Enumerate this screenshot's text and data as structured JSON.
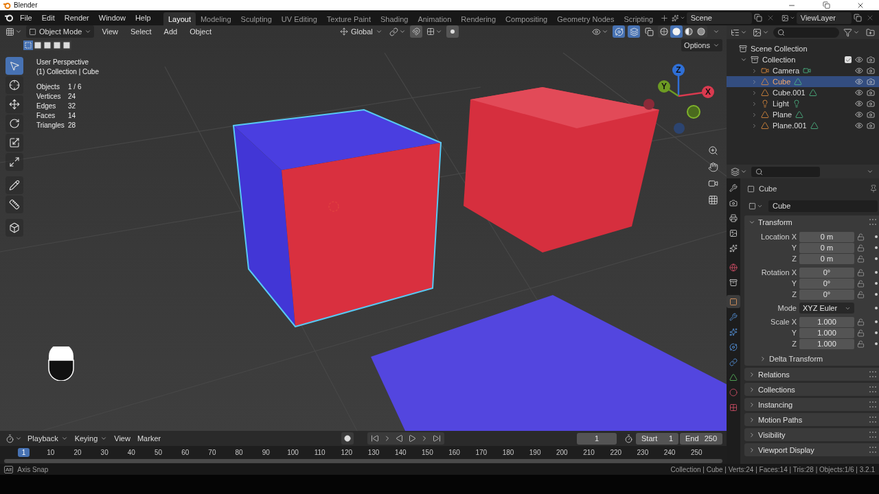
{
  "window": {
    "title": "Blender"
  },
  "menu": [
    "File",
    "Edit",
    "Render",
    "Window",
    "Help"
  ],
  "workspaces": [
    {
      "label": "Layout",
      "selected": true
    },
    {
      "label": "Modeling",
      "selected": false
    },
    {
      "label": "Sculpting",
      "selected": false
    },
    {
      "label": "UV Editing",
      "selected": false
    },
    {
      "label": "Texture Paint",
      "selected": false
    },
    {
      "label": "Shading",
      "selected": false
    },
    {
      "label": "Animation",
      "selected": false
    },
    {
      "label": "Rendering",
      "selected": false
    },
    {
      "label": "Compositing",
      "selected": false
    },
    {
      "label": "Geometry Nodes",
      "selected": false
    },
    {
      "label": "Scripting",
      "selected": false
    }
  ],
  "scene": {
    "value": "Scene"
  },
  "view_layer": {
    "value": "ViewLayer"
  },
  "viewport": {
    "mode": "Object Mode",
    "menus": [
      "View",
      "Select",
      "Add",
      "Object"
    ],
    "orientation": "Global",
    "options": "Options",
    "toggles": [
      {
        "kind": "gizmo",
        "on": true
      },
      {
        "kind": "overlay",
        "on": true
      },
      {
        "kind": "xray",
        "on": false
      }
    ],
    "shading": [
      {
        "kind": "wireframe",
        "selected": false
      },
      {
        "kind": "solid",
        "selected": true
      },
      {
        "kind": "material",
        "selected": false
      },
      {
        "kind": "rendered",
        "selected": false
      }
    ],
    "select_modes": [
      {
        "selected": true
      },
      {
        "selected": false
      },
      {
        "selected": false
      },
      {
        "selected": false
      },
      {
        "selected": false
      }
    ],
    "tools": [
      {
        "kind": "select",
        "selected": true
      },
      {
        "kind": "cursor",
        "selected": false
      },
      {
        "kind": "move",
        "selected": false
      },
      {
        "kind": "rotate",
        "selected": false
      },
      {
        "kind": "scale",
        "selected": false
      },
      {
        "kind": "transform",
        "selected": false
      },
      {
        "kind": "annotate",
        "selected": false
      },
      {
        "kind": "measure",
        "selected": false
      },
      {
        "kind": "add",
        "selected": false
      }
    ],
    "perspective": "User Perspective",
    "context": "(1) Collection | Cube",
    "stats": [
      {
        "label": "Objects",
        "value": "1 / 6"
      },
      {
        "label": "Vertices",
        "value": "24"
      },
      {
        "label": "Edges",
        "value": "32"
      },
      {
        "label": "Faces",
        "value": "14"
      },
      {
        "label": "Triangles",
        "value": "28"
      }
    ],
    "gizmo": [
      "Z",
      "Y",
      "X"
    ]
  },
  "outliner": {
    "root": "Scene Collection",
    "collection": {
      "label": "Collection",
      "expanded": true,
      "checked": true,
      "children": [
        {
          "label": "Camera",
          "kind": "camera",
          "selected": false
        },
        {
          "label": "Cube",
          "kind": "mesh",
          "selected": true
        },
        {
          "label": "Cube.001",
          "kind": "mesh",
          "selected": false
        },
        {
          "label": "Light",
          "kind": "light",
          "selected": false
        },
        {
          "label": "Plane",
          "kind": "mesh",
          "selected": false
        },
        {
          "label": "Plane.001",
          "kind": "mesh",
          "selected": false
        }
      ]
    }
  },
  "properties": {
    "object": "Cube",
    "name_field": "Cube",
    "tabs": [
      {
        "kind": "tool",
        "selected": false
      },
      {
        "kind": "render",
        "selected": false
      },
      {
        "kind": "output",
        "selected": false
      },
      {
        "kind": "view-layer",
        "selected": false
      },
      {
        "kind": "scene",
        "selected": false
      },
      {
        "kind": "world",
        "selected": false
      },
      {
        "kind": "collection",
        "selected": false
      },
      {
        "kind": "object",
        "selected": true
      },
      {
        "kind": "modifier",
        "selected": false
      },
      {
        "kind": "particles",
        "selected": false
      },
      {
        "kind": "physics",
        "selected": false
      },
      {
        "kind": "constraints",
        "selected": false
      },
      {
        "kind": "data",
        "selected": false
      },
      {
        "kind": "material",
        "selected": false
      },
      {
        "kind": "texture",
        "selected": false
      }
    ],
    "transform": {
      "title": "Transform",
      "expanded": true,
      "groups": [
        [
          {
            "label": "Location X",
            "value": "0 m",
            "kind": "number",
            "locked": false
          },
          {
            "label": "Y",
            "value": "0 m",
            "kind": "number",
            "locked": false
          },
          {
            "label": "Z",
            "value": "0 m",
            "kind": "number",
            "locked": false
          }
        ],
        [
          {
            "label": "Rotation X",
            "value": "0°",
            "kind": "number",
            "locked": false
          },
          {
            "label": "Y",
            "value": "0°",
            "kind": "number",
            "locked": false
          },
          {
            "label": "Z",
            "value": "0°",
            "kind": "number",
            "locked": false
          }
        ],
        [
          {
            "label": "Mode",
            "value": "XYZ Euler",
            "kind": "dropdown"
          }
        ],
        [
          {
            "label": "Scale X",
            "value": "1.000",
            "kind": "number",
            "locked": false
          },
          {
            "label": "Y",
            "value": "1.000",
            "kind": "number",
            "locked": false
          },
          {
            "label": "Z",
            "value": "1.000",
            "kind": "number",
            "locked": false
          }
        ]
      ],
      "subpanel": {
        "title": "Delta Transform",
        "expanded": false
      }
    },
    "panels": [
      {
        "title": "Relations",
        "expanded": false
      },
      {
        "title": "Collections",
        "expanded": false
      },
      {
        "title": "Instancing",
        "expanded": false
      },
      {
        "title": "Motion Paths",
        "expanded": false
      },
      {
        "title": "Visibility",
        "expanded": false
      },
      {
        "title": "Viewport Display",
        "expanded": false
      }
    ]
  },
  "timeline": {
    "menus": [
      {
        "label": "Playback",
        "dropdown": true
      },
      {
        "label": "Keying",
        "dropdown": true
      },
      {
        "label": "View",
        "dropdown": false
      },
      {
        "label": "Marker",
        "dropdown": false
      }
    ],
    "current_frame": "1",
    "start_label": "Start",
    "start": "1",
    "end_label": "End",
    "end": "250",
    "ticks": [
      {
        "label": "1",
        "selected": true
      },
      {
        "label": "10",
        "selected": false
      },
      {
        "label": "20",
        "selected": false
      },
      {
        "label": "30",
        "selected": false
      },
      {
        "label": "40",
        "selected": false
      },
      {
        "label": "50",
        "selected": false
      },
      {
        "label": "60",
        "selected": false
      },
      {
        "label": "70",
        "selected": false
      },
      {
        "label": "80",
        "selected": false
      },
      {
        "label": "90",
        "selected": false
      },
      {
        "label": "100",
        "selected": false
      },
      {
        "label": "110",
        "selected": false
      },
      {
        "label": "120",
        "selected": false
      },
      {
        "label": "130",
        "selected": false
      },
      {
        "label": "140",
        "selected": false
      },
      {
        "label": "150",
        "selected": false
      },
      {
        "label": "160",
        "selected": false
      },
      {
        "label": "170",
        "selected": false
      },
      {
        "label": "180",
        "selected": false
      },
      {
        "label": "190",
        "selected": false
      },
      {
        "label": "200",
        "selected": false
      },
      {
        "label": "210",
        "selected": false
      },
      {
        "label": "220",
        "selected": false
      },
      {
        "label": "230",
        "selected": false
      },
      {
        "label": "240",
        "selected": false
      },
      {
        "label": "250",
        "selected": false
      }
    ]
  },
  "status_bar": {
    "hint_key": "Alt",
    "hint": "Axis Snap",
    "stats": "Collection | Cube | Verts:24 | Faces:14 | Tris:28 | Objects:1/6 | 3.2.1"
  }
}
